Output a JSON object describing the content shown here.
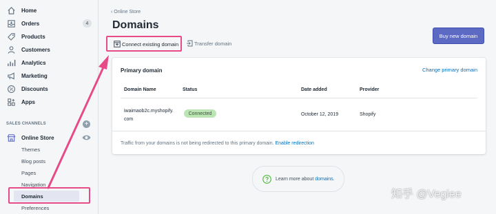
{
  "sidebar": {
    "items": [
      {
        "label": "Home",
        "icon": "home-icon"
      },
      {
        "label": "Orders",
        "icon": "orders-icon",
        "badge": "4"
      },
      {
        "label": "Products",
        "icon": "products-icon"
      },
      {
        "label": "Customers",
        "icon": "customers-icon"
      },
      {
        "label": "Analytics",
        "icon": "analytics-icon"
      },
      {
        "label": "Marketing",
        "icon": "marketing-icon"
      },
      {
        "label": "Discounts",
        "icon": "discounts-icon"
      },
      {
        "label": "Apps",
        "icon": "apps-icon"
      }
    ],
    "sales_channels_heading": "SALES CHANNELS",
    "online_store_label": "Online Store",
    "sub_items": [
      "Themes",
      "Blog posts",
      "Pages",
      "Navigation",
      "Domains",
      "Preferences"
    ],
    "active_sub_item": "Domains"
  },
  "main": {
    "breadcrumb": "Online Store",
    "title": "Domains",
    "connect_label": "Connect existing domain",
    "transfer_label": "Transfer domain",
    "buy_label": "Buy new domain",
    "card": {
      "title": "Primary domain",
      "change_link": "Change primary domain",
      "columns": [
        "Domain Name",
        "Status",
        "Date added",
        "Provider"
      ],
      "row": {
        "domain_line1": "iwaimaob2c.myshopify.",
        "domain_line2": "com",
        "status": "Connected",
        "date_added": "October 12, 2019",
        "provider": "Shopify"
      },
      "footer_text": "Traffic from your domains is not being redirected to this primary domain.",
      "footer_link": "Enable redirection"
    },
    "learn_prefix": "Learn more about",
    "learn_link": "domains."
  },
  "watermark": "知乎 @Vegiee",
  "colors": {
    "accent": "#5c6ac4",
    "annotation": "#e64a87",
    "link": "#006fbb",
    "status_badge": "#bbe5b3"
  }
}
